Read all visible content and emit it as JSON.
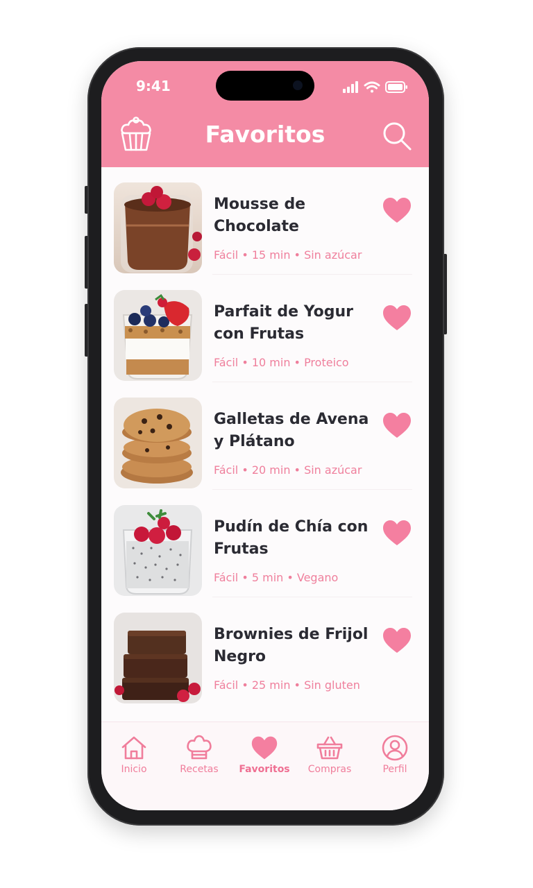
{
  "status_bar": {
    "time": "9:41"
  },
  "header": {
    "title": "Favoritos",
    "left_icon": "cupcake-icon",
    "right_icon": "search-icon"
  },
  "recipes": [
    {
      "title": "Mousse de Chocolate",
      "meta": "Fácil • 15 min • Sin azúcar",
      "favorite": true,
      "image": "chocolate-mousse-glass"
    },
    {
      "title": "Parfait de Yogur con Frutas",
      "meta": "Fácil • 10 min • Proteico",
      "favorite": true,
      "image": "yogurt-parfait-glass"
    },
    {
      "title": "Galletas de Avena y Plátano",
      "meta": "Fácil • 20 min • Sin azúcar",
      "favorite": true,
      "image": "oat-cookies-stack"
    },
    {
      "title": "Pudín de Chía con Frutas",
      "meta": "Fácil • 5 min • Vegano",
      "favorite": true,
      "image": "chia-pudding-glass"
    },
    {
      "title": "Brownies de Frijol Negro",
      "meta": "Fácil • 25 min • Sin gluten",
      "favorite": true,
      "image": "brownie-stack"
    }
  ],
  "tabbar": {
    "tabs": [
      {
        "label": "Inicio",
        "icon": "home-icon",
        "active": false
      },
      {
        "label": "Recetas",
        "icon": "chef-hat-icon",
        "active": false
      },
      {
        "label": "Favoritos",
        "icon": "heart-icon",
        "active": true
      },
      {
        "label": "Compras",
        "icon": "basket-icon",
        "active": false
      },
      {
        "label": "Perfil",
        "icon": "user-icon",
        "active": false
      }
    ]
  },
  "colors": {
    "accent": "#f48ba5",
    "heart": "#f47fa0",
    "title_text": "#2b2b33",
    "meta_text": "#ef7f9c"
  }
}
